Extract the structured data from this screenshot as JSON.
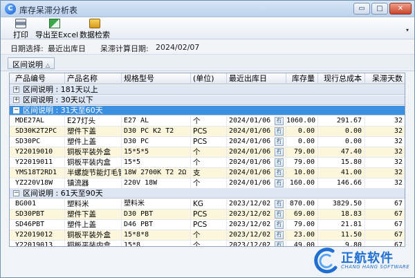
{
  "window": {
    "title": "库存呆滞分析表",
    "icon": "app-logo-icon",
    "controls": {
      "minimize": "▭",
      "maximize": "□",
      "close": "✕"
    }
  },
  "toolbar": {
    "print_label": "打印",
    "export_label": "导出至Excel",
    "search_label": "数据检索",
    "overflow": "▾"
  },
  "info": {
    "date_select_label": "日期选择:",
    "date_select_value": "最近出库日",
    "calc_date_label": "呆滞计算日期:",
    "calc_date_value": "2024/02/07"
  },
  "group_panel": {
    "chip_label": "区间说明",
    "chip_arrow": "△"
  },
  "grid": {
    "columns": [
      "产品编号",
      "产品名称",
      "规格型号",
      "(单位)",
      "最近出库日",
      "库存量",
      "现行总成本",
      "呆滞天数"
    ],
    "groups": [
      {
        "expander": "+",
        "label": "区间说明 : 181天以上",
        "selected": false,
        "rows": []
      },
      {
        "expander": "+",
        "label": "区间说明 : 30天以下",
        "selected": false,
        "rows": []
      },
      {
        "expander": "−",
        "label": "区间说明 : 31天至60天",
        "selected": true,
        "rows": [
          [
            "MDE27AL",
            "E27灯头",
            "E27 AL",
            "个",
            "2024/01/06",
            "1060.00",
            "291.67",
            "32"
          ],
          [
            "SD30K2T2PC",
            "塑件下盖",
            "D30 PC K2 T2",
            "PCS",
            "2024/01/06",
            "0.00",
            "0.00",
            "32"
          ],
          [
            "SD30PC",
            "塑件上盖",
            "D30 PC",
            "PCS",
            "2024/01/06",
            "0.00",
            "0.00",
            "32"
          ],
          [
            "Y22019010",
            "铜板平装外盒",
            "15*5*5",
            "个",
            "2024/01/06",
            "79.00",
            "47.40",
            "32"
          ],
          [
            "Y22019011",
            "铜板平装内盒",
            "15*5",
            "个",
            "2024/01/06",
            "79.00",
            "15.80",
            "32"
          ],
          [
            "YMS18T2RD1",
            "半螺旋节能灯毛管",
            "18W 2700K T2 2Ω",
            "支",
            "2024/01/06",
            "10.00",
            "41.00",
            "32"
          ],
          [
            "YZ220V18W",
            "镇流器",
            "220V 18W",
            "个",
            "2024/01/06",
            "160.00",
            "146.66",
            "32"
          ]
        ]
      },
      {
        "expander": "−",
        "label": "区间说明 : 61天至90天",
        "selected": false,
        "rows": [
          [
            "BG001",
            "塑料米",
            "塑料米",
            "KG",
            "2023/12/02",
            "870.00",
            "3829.50",
            "67"
          ],
          [
            "SD30PBT",
            "塑件下盖",
            "D30 PBT",
            "PCS",
            "2023/12/02",
            "69.00",
            "18.83",
            "67"
          ],
          [
            "SD46PBT",
            "塑件上盖",
            "D46 PBT",
            "PCS",
            "2023/12/02",
            "79.00",
            "21.81",
            "67"
          ],
          [
            "Y22019012",
            "铜板平装外盒",
            "15*8*8",
            "个",
            "2023/12/02",
            "23.00",
            "11.50",
            "67"
          ],
          [
            "Y22019013",
            "铜板平装内盒",
            "15*8",
            "个",
            "2023/12/02",
            "49.00",
            "9.80",
            "67"
          ]
        ]
      }
    ],
    "calendar_glyph": "冇"
  },
  "logo": {
    "name": "正航软件",
    "sub": "CHANG HANG SOFTWARE",
    "color": "#1f6fd1"
  }
}
